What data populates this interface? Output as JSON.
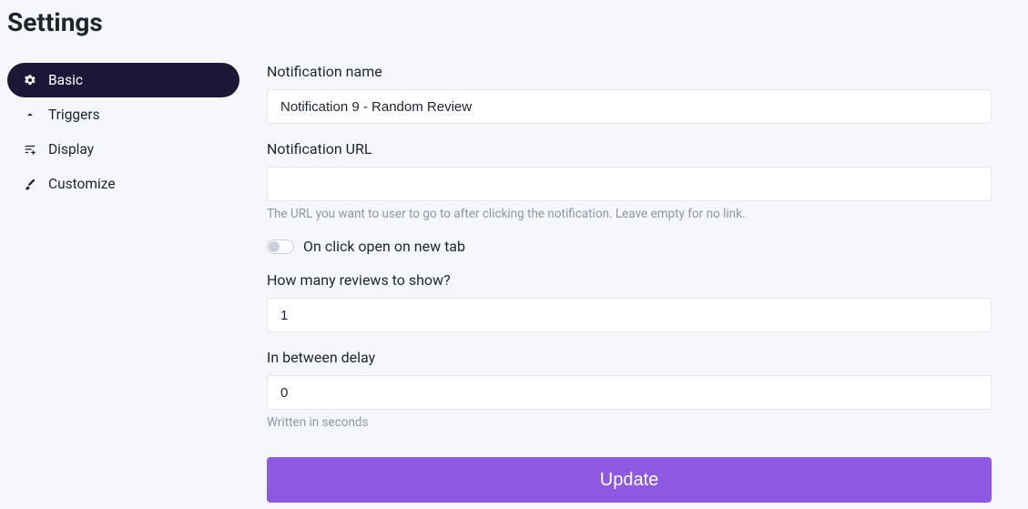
{
  "title": "Settings",
  "sidebar": {
    "items": [
      {
        "label": "Basic"
      },
      {
        "label": "Triggers"
      },
      {
        "label": "Display"
      },
      {
        "label": "Customize"
      }
    ]
  },
  "form": {
    "name_label": "Notification name",
    "name_value": "Notification 9 - Random Review",
    "url_label": "Notification URL",
    "url_value": "",
    "url_help": "The URL you want to user to go to after clicking the notification. Leave empty for no link.",
    "newtab_label": "On click open on new tab",
    "reviews_label": "How many reviews to show?",
    "reviews_value": "1",
    "delay_label": "In between delay",
    "delay_value": "0",
    "delay_help": "Written in seconds",
    "submit_label": "Update"
  }
}
